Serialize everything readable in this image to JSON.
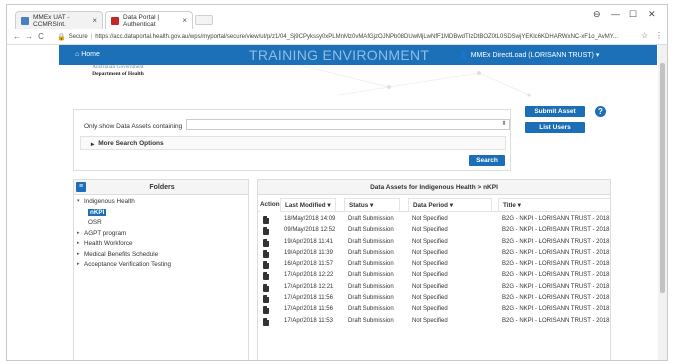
{
  "browser": {
    "tabs": [
      {
        "label": "MMEx UAT - CCMRSInt.",
        "active": false
      },
      {
        "label": "Data Portal | Authenticat",
        "active": true
      }
    ],
    "address": {
      "secure_label": "Secure",
      "url": "https://acc.dataportal.health.gov.au/wps/myportal/secure/view/ut/p/z1/04_Sj9CPykssy0xPLMnMz0vMAfGjzOJNPb08DUwMjLwNfF1MDBwdTIzDtBOZ0tL0SDSwjYEKlc6KDHARWxNC-xF1o_AvMY..."
    },
    "window_controls": [
      "⊖",
      "—",
      "☐",
      "✕"
    ]
  },
  "header": {
    "home_label": "Home",
    "environment": "TRAINING ENVIRONMENT",
    "user_label": "MMEx DirectLoad (LORISANN TRUST) ▾"
  },
  "logo": {
    "top_text": "Australian Government",
    "main_text": "Department of Health"
  },
  "search": {
    "label": "Only show Data Assets containing",
    "value": "",
    "more_options": "More Search Options",
    "search_button": "Search"
  },
  "actions": {
    "submit_asset": "Submit Asset",
    "list_users": "List Users",
    "help": "?"
  },
  "folders": {
    "title": "Folders",
    "tree": [
      {
        "label": "Indigenous Health",
        "expanded": true,
        "children": [
          {
            "label": "nKPI",
            "selected": true
          },
          {
            "label": "OSR",
            "selected": false
          }
        ]
      },
      {
        "label": "AGPT program"
      },
      {
        "label": "Health Workforce"
      },
      {
        "label": "Medical Benefits Schedule"
      },
      {
        "label": "Acceptance Verification Testing"
      }
    ]
  },
  "assets": {
    "title": "Data Assets for Indigenous Health > nKPI",
    "columns": [
      "Action",
      "Last Modified ▾",
      "Status ▾",
      "Data Period ▾",
      "Title ▾"
    ],
    "rows": [
      {
        "modified": "18/May/2018 14:09",
        "status": "Draft Submission",
        "period": "Not Specified",
        "title": "B2G - NKPI - LORISANN TRUST - 2018"
      },
      {
        "modified": "09/May/2018 12:52",
        "status": "Draft Submission",
        "period": "Not Specified",
        "title": "B2G - NKPI - LORISANN TRUST - 2018"
      },
      {
        "modified": "19/Apr/2018 11:41",
        "status": "Draft Submission",
        "period": "Not Specified",
        "title": "B2G - NKPI - LORISANN TRUST - 2018"
      },
      {
        "modified": "19/Apr/2018 11:39",
        "status": "Draft Submission",
        "period": "Not Specified",
        "title": "B2G - NKPI - LORISANN TRUST - 2018"
      },
      {
        "modified": "16/Apr/2018 11:57",
        "status": "Draft Submission",
        "period": "Not Specified",
        "title": "B2G - NKPI - LORISANN TRUST - 2018"
      },
      {
        "modified": "17/Apr/2018 12:22",
        "status": "Draft Submission",
        "period": "Not Specified",
        "title": "B2G - NKPI - LORISANN TRUST - 2018"
      },
      {
        "modified": "17/Apr/2018 12:21",
        "status": "Draft Submission",
        "period": "Not Specified",
        "title": "B2G - NKPI - LORISANN TRUST - 2018"
      },
      {
        "modified": "17/Apr/2018 11:56",
        "status": "Draft Submission",
        "period": "Not Specified",
        "title": "B2G - NKPI - LORISANN TRUST - 2018"
      },
      {
        "modified": "17/Apr/2018 11:56",
        "status": "Draft Submission",
        "period": "Not Specified",
        "title": "B2G - NKPI - LORISANN TRUST - 2018"
      },
      {
        "modified": "17/Apr/2018 11:53",
        "status": "Draft Submission",
        "period": "Not Specified",
        "title": "B2G - NKPI - LORISANN TRUST - 2018"
      }
    ]
  },
  "colors": {
    "header_blue": "#1c70b8",
    "button_blue": "#1c6fb7",
    "environment_text": "#8fbde6"
  }
}
